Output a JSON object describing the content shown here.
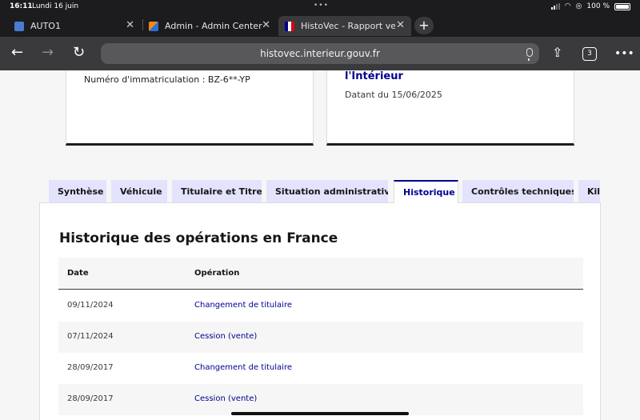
{
  "status_bar": {
    "time": "16:11",
    "date": "Lundi 16 juin",
    "battery": "100 %"
  },
  "browser": {
    "tabs": [
      {
        "title": "AUTO1",
        "favicon_color": "#4a7bd4"
      },
      {
        "title": "Admin - Admin Center",
        "favicon_color": "#f08a1c"
      },
      {
        "title": "HistoVec - Rapport vendeur",
        "favicon_color": "#000091"
      }
    ],
    "url": "histovec.interieur.gouv.fr",
    "tab_count": "3"
  },
  "cards": {
    "plate": "Numéro d'immatriculation : BZ-6**-YP",
    "authority": "l'Intérieur",
    "dated": "Datant du 15/06/2025"
  },
  "nav_tabs": [
    "Synthèse",
    "Véhicule",
    "Titulaire et Titre",
    "Situation administrative",
    "Historique",
    "Contrôles techniques",
    "Kilo"
  ],
  "active_tab": "Historique",
  "section": {
    "title": "Historique des opérations en France",
    "columns": {
      "date": "Date",
      "operation": "Opération"
    },
    "rows": [
      {
        "date": "09/11/2024",
        "operation": "Changement de titulaire"
      },
      {
        "date": "07/11/2024",
        "operation": "Cession (vente)"
      },
      {
        "date": "28/09/2017",
        "operation": "Changement de titulaire"
      },
      {
        "date": "28/09/2017",
        "operation": "Cession (vente)"
      }
    ]
  }
}
